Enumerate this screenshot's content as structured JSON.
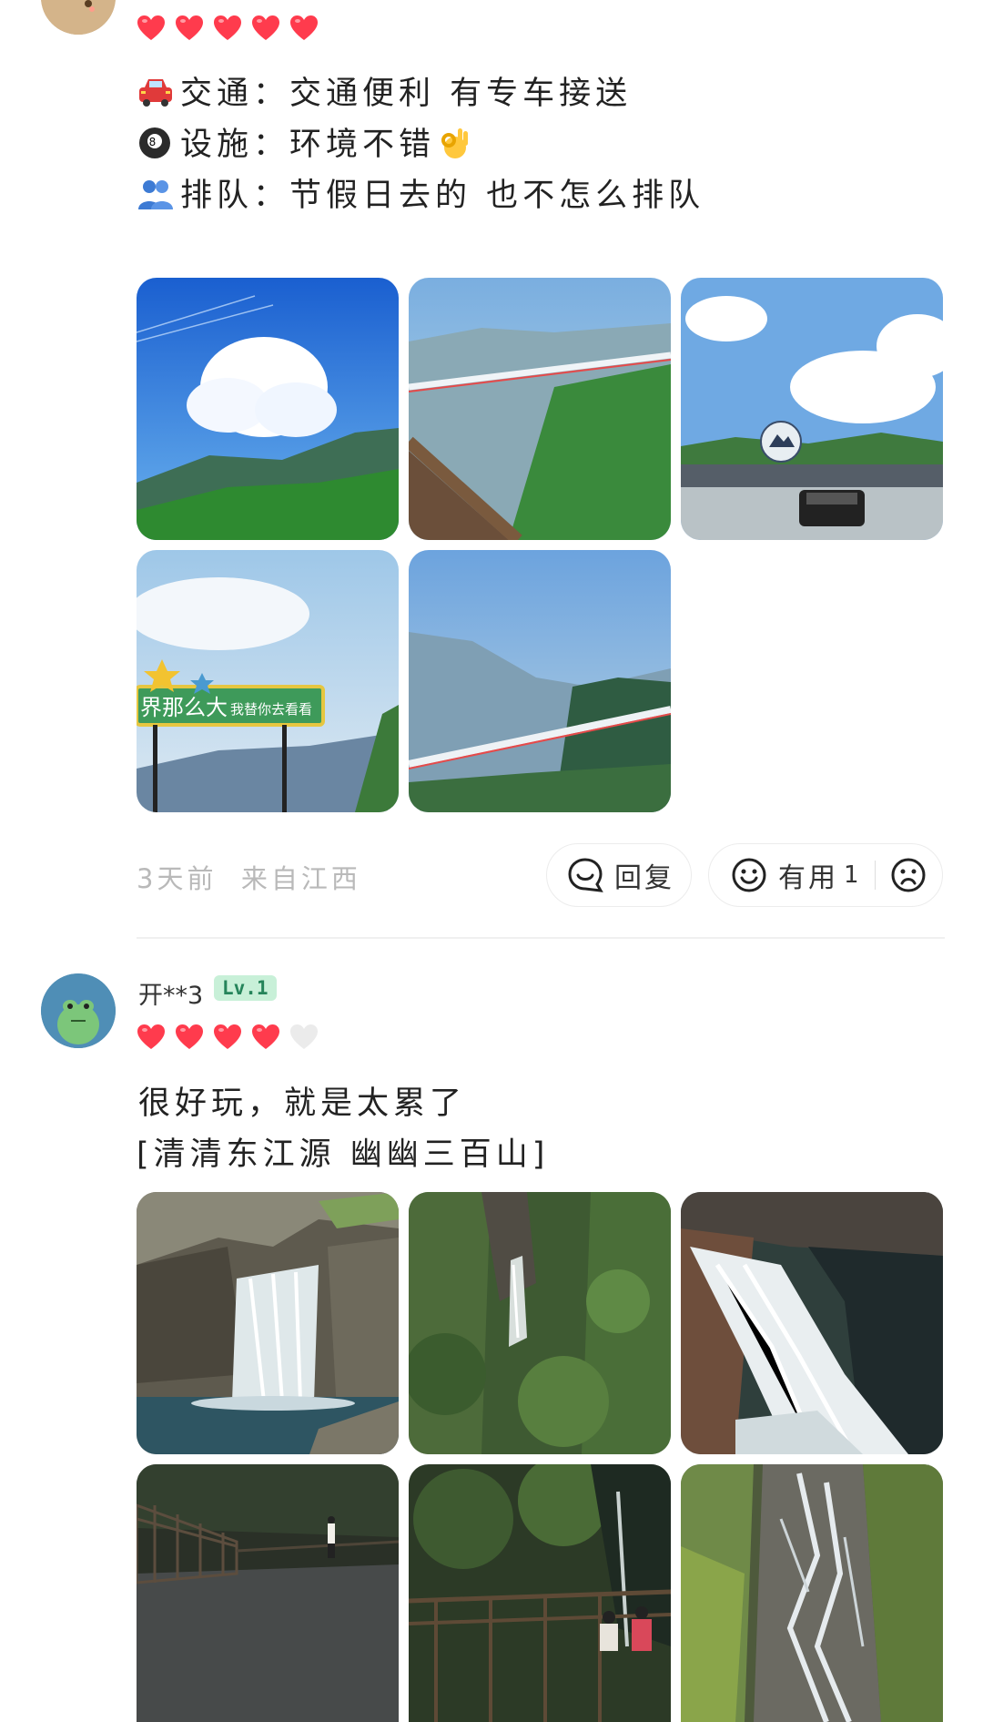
{
  "review1": {
    "rating": 5,
    "lines": [
      {
        "icon": "car-icon",
        "label": "交通",
        "text": "交通便利 有专车接送"
      },
      {
        "icon": "8-ball-icon",
        "label": "设施",
        "text": "环境不错"
      },
      {
        "icon": "people-icon",
        "label": "排队",
        "text": "节假日去的 也不怎么排队"
      }
    ],
    "separator": "：",
    "photos": [
      "sky-cloud-mountain",
      "glass-bridge-valley",
      "scenic-gate-car",
      "signboard-star",
      "bridge-mountains"
    ],
    "time": "3天前",
    "location": "来自江西",
    "reply_label": "回复",
    "useful_label": "有用",
    "useful_count": "1"
  },
  "review2": {
    "username": "开**3",
    "level": "Lv.1",
    "rating": 4,
    "text_line1": "很好玩，就是太累了",
    "text_line2": "[清清东江源 幽幽三百山]",
    "photos": [
      "waterfall-pool",
      "waterfall-forest",
      "waterfall-rocks",
      "dark-path",
      "forest-railing",
      "cascade-rocks"
    ]
  },
  "colors": {
    "heart_on": "#ff3b4d",
    "heart_off": "#ebebeb",
    "level_bg": "#c8f0d8",
    "level_text": "#25845a"
  }
}
